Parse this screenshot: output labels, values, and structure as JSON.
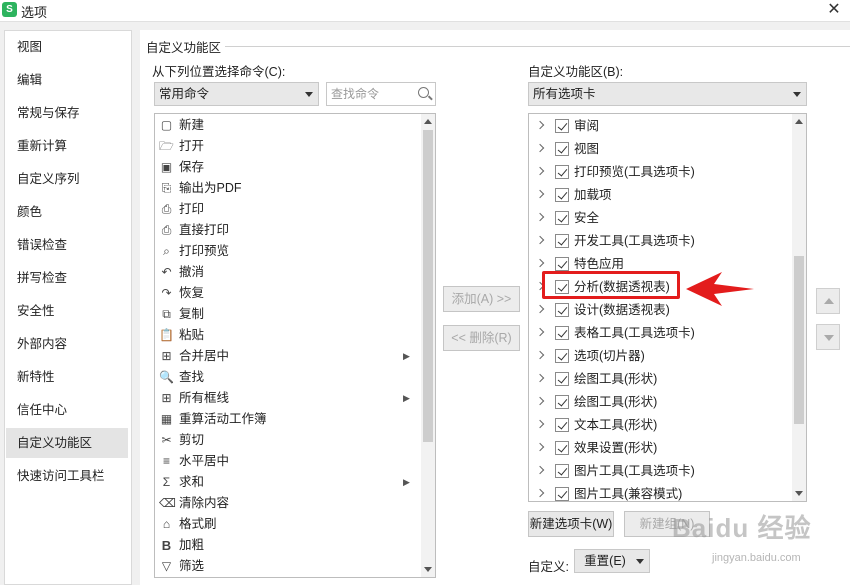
{
  "window": {
    "title": "选项",
    "app_icon": "S",
    "close_label": "✕"
  },
  "sidebar": {
    "items": [
      {
        "label": "视图"
      },
      {
        "label": "编辑"
      },
      {
        "label": "常规与保存"
      },
      {
        "label": "重新计算"
      },
      {
        "label": "自定义序列"
      },
      {
        "label": "颜色"
      },
      {
        "label": "错误检查"
      },
      {
        "label": "拼写检查"
      },
      {
        "label": "安全性"
      },
      {
        "label": "外部内容"
      },
      {
        "label": "新特性"
      },
      {
        "label": "信任中心"
      },
      {
        "label": "自定义功能区",
        "active": true
      },
      {
        "label": "快速访问工具栏"
      }
    ]
  },
  "group_title": "自定义功能区",
  "left_panel": {
    "label": "从下列位置选择命令(C):",
    "combo_value": "常用命令",
    "search_placeholder": "查找命令",
    "commands": [
      {
        "label": "新建",
        "icon": "new-doc-icon",
        "glyph": "▢"
      },
      {
        "label": "打开",
        "icon": "folder-open-icon",
        "glyph": "🗁"
      },
      {
        "label": "保存",
        "icon": "save-icon",
        "glyph": "▣"
      },
      {
        "label": "输出为PDF",
        "icon": "pdf-icon",
        "glyph": "⎘"
      },
      {
        "label": "打印",
        "icon": "print-icon",
        "glyph": "⎙"
      },
      {
        "label": "直接打印",
        "icon": "direct-print-icon",
        "glyph": "⎙"
      },
      {
        "label": "打印预览",
        "icon": "print-preview-icon",
        "glyph": "⌕"
      },
      {
        "label": "撤消",
        "icon": "undo-icon",
        "glyph": "↶"
      },
      {
        "label": "恢复",
        "icon": "redo-icon",
        "glyph": "↷"
      },
      {
        "label": "复制",
        "icon": "copy-icon",
        "glyph": "⧉"
      },
      {
        "label": "粘贴",
        "icon": "paste-icon",
        "glyph": "📋"
      },
      {
        "label": "合并居中",
        "icon": "merge-center-icon",
        "glyph": "⊞",
        "submenu": true
      },
      {
        "label": "查找",
        "icon": "find-icon",
        "glyph": "🔍"
      },
      {
        "label": "所有框线",
        "icon": "borders-icon",
        "glyph": "⊞",
        "submenu": true
      },
      {
        "label": "重算活动工作簿",
        "icon": "recalc-icon",
        "glyph": "▦"
      },
      {
        "label": "剪切",
        "icon": "cut-icon",
        "glyph": "✂"
      },
      {
        "label": "水平居中",
        "icon": "align-center-icon",
        "glyph": "≡"
      },
      {
        "label": "求和",
        "icon": "sum-icon",
        "glyph": "Σ",
        "submenu": true
      },
      {
        "label": "清除内容",
        "icon": "clear-content-icon",
        "glyph": "⌫"
      },
      {
        "label": "格式刷",
        "icon": "format-painter-icon",
        "glyph": "⌂"
      },
      {
        "label": "加粗",
        "icon": "bold-icon",
        "glyph": "B"
      },
      {
        "label": "筛选",
        "icon": "filter-icon",
        "glyph": "▽"
      }
    ]
  },
  "middle": {
    "add_label": "添加(A) >>",
    "remove_label": "<< 删除(R)"
  },
  "right_panel": {
    "label": "自定义功能区(B):",
    "combo_value": "所有选项卡",
    "tabs": [
      {
        "label": "审阅",
        "checked": true
      },
      {
        "label": "视图",
        "checked": true
      },
      {
        "label": "打印预览(工具选项卡)",
        "checked": true
      },
      {
        "label": "加载项",
        "checked": true
      },
      {
        "label": "安全",
        "checked": true
      },
      {
        "label": "开发工具(工具选项卡)",
        "checked": true
      },
      {
        "label": "特色应用",
        "checked": true
      },
      {
        "label": "分析(数据透视表)",
        "checked": true
      },
      {
        "label": "设计(数据透视表)",
        "checked": true
      },
      {
        "label": "表格工具(工具选项卡)",
        "checked": true
      },
      {
        "label": "选项(切片器)",
        "checked": true
      },
      {
        "label": "绘图工具(形状)",
        "checked": true
      },
      {
        "label": "绘图工具(形状)",
        "checked": true
      },
      {
        "label": "文本工具(形状)",
        "checked": true
      },
      {
        "label": "效果设置(形状)",
        "checked": true
      },
      {
        "label": "图片工具(工具选项卡)",
        "checked": true
      },
      {
        "label": "图片工具(兼容模式)",
        "checked": true
      }
    ],
    "new_tab_label": "新建选项卡(W)",
    "new_group_label": "新建组(N)",
    "custom_label": "自定义:",
    "reset_label": "重置(E)"
  },
  "watermark": {
    "text": "Baidu 经验",
    "url": "jingyan.baidu.com"
  },
  "colors": {
    "highlight": "#e31c1c",
    "arrow": "#e31c1c",
    "app_icon": "#2db35e"
  }
}
